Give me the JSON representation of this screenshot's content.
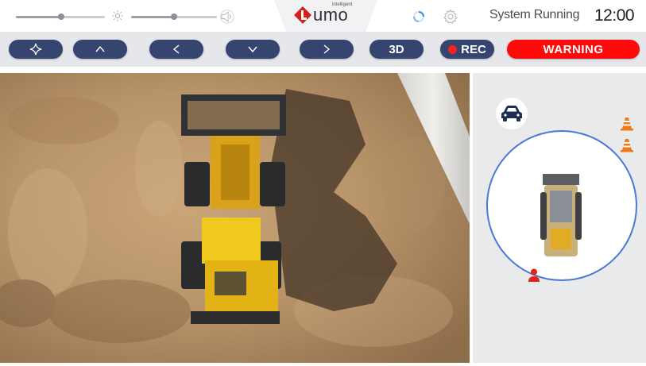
{
  "top": {
    "brightness_level": 0.5,
    "volume_level": 0.5,
    "logo_text": "umo",
    "logo_tagline": "intelligent",
    "system_status": "System Running",
    "clock": "12:00"
  },
  "toolbar": {
    "buttons": [
      {
        "name": "view-mode",
        "icon": "four-point-star-icon"
      },
      {
        "name": "up",
        "icon": "chevron-up-icon"
      },
      {
        "name": "left",
        "icon": "chevron-left-icon"
      },
      {
        "name": "down",
        "icon": "chevron-down-icon"
      },
      {
        "name": "right",
        "icon": "chevron-right-icon"
      }
    ],
    "view_3d_label": "3D",
    "rec_label": "REC",
    "warning_label": "WARNING"
  },
  "colors": {
    "button": "#36456f",
    "warning": "#ff0a0a",
    "rec_dot": "#ff1f1f",
    "radar_ring": "#4a78d6",
    "cone": "#f07a1a",
    "person": "#e0251b"
  },
  "radar": {
    "icons": [
      "car-icon",
      "traffic-cone-icon",
      "traffic-cone-icon",
      "person-icon"
    ]
  }
}
